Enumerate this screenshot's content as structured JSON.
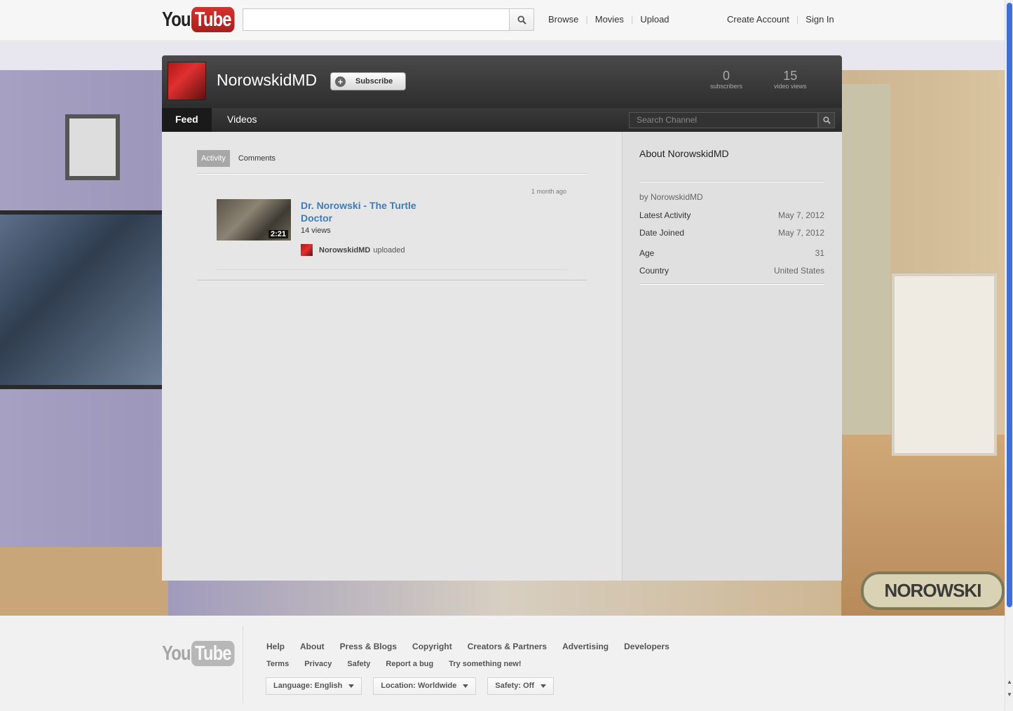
{
  "masthead": {
    "logo_you": "You",
    "logo_tube": "Tube",
    "search_value": "",
    "nav_left": [
      "Browse",
      "Movies",
      "Upload"
    ],
    "nav_right": [
      "Create Account",
      "Sign In"
    ]
  },
  "channel": {
    "name": "NorowskidMD",
    "subscribe_label": "Subscribe",
    "subscribers": "0",
    "subscribers_label": "subscribers",
    "views": "15",
    "views_label": "video views",
    "tabs": [
      "Feed",
      "Videos"
    ],
    "search_placeholder": "Search Channel"
  },
  "feed": {
    "tabs": [
      "Activity",
      "Comments"
    ],
    "time": "1 month ago",
    "video": {
      "title": "Dr. Norowski - The Turtle Doctor",
      "duration": "2:21",
      "views": "14 views",
      "uploader": "NorowskidMD",
      "action": "uploaded"
    }
  },
  "about": {
    "title": "About NorowskidMD",
    "by": "by NorowskidMD",
    "rows": [
      {
        "label": "Latest Activity",
        "value": "May 7, 2012"
      },
      {
        "label": "Date Joined",
        "value": "May 7, 2012"
      },
      {
        "label": "Age",
        "value": "31"
      },
      {
        "label": "Country",
        "value": "United States"
      }
    ]
  },
  "background": {
    "brand_logo_text": "NOROWSKI"
  },
  "footer": {
    "links_primary": [
      "Help",
      "About",
      "Press & Blogs",
      "Copyright",
      "Creators & Partners",
      "Advertising",
      "Developers"
    ],
    "links_secondary": [
      "Terms",
      "Privacy",
      "Safety",
      "Report a bug",
      "Try something new!"
    ],
    "pickers": [
      "Language: English",
      "Location: Worldwide",
      "Safety: Off"
    ]
  },
  "colors": {
    "youtube_red": "#c4302b",
    "link_blue": "#3a7dbf",
    "scroll_thumb": "#3d6fd6"
  }
}
